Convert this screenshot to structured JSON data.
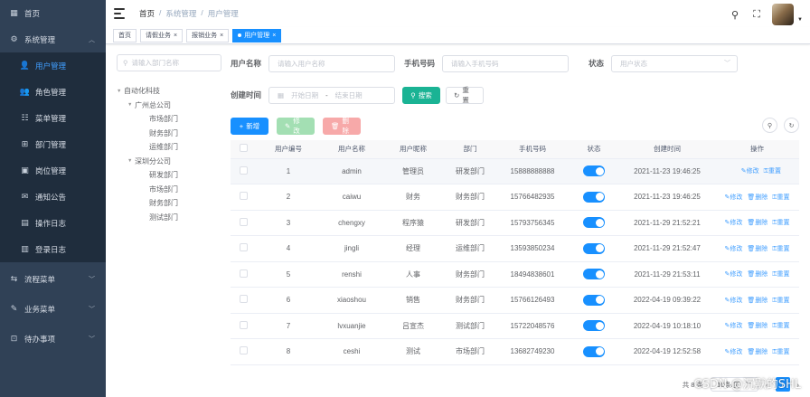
{
  "sidebar": {
    "home": "首页",
    "system": "系统管理",
    "sub": [
      {
        "label": "用户管理",
        "icon": "user-icon"
      },
      {
        "label": "角色管理",
        "icon": "people-icon"
      },
      {
        "label": "菜单管理",
        "icon": "tree-table-icon"
      },
      {
        "label": "部门管理",
        "icon": "tree-icon"
      },
      {
        "label": "岗位管理",
        "icon": "post-icon"
      },
      {
        "label": "通知公告",
        "icon": "message-icon"
      },
      {
        "label": "操作日志",
        "icon": "form-icon"
      },
      {
        "label": "登录日志",
        "icon": "logininfor-icon"
      }
    ],
    "groups": [
      "流程菜单",
      "业务菜单",
      "待办事项"
    ]
  },
  "navbar": {
    "breadcrumb": [
      "首页",
      "系统管理",
      "用户管理"
    ],
    "sep": "/"
  },
  "tags": [
    {
      "label": "首页"
    },
    {
      "label": "请假业务",
      "close": "×"
    },
    {
      "label": "报销业务",
      "close": "×"
    },
    {
      "label": "用户管理",
      "close": "×"
    }
  ],
  "dept": {
    "placeholder": "请输入部门名称",
    "tree": [
      {
        "label": "自动化科技",
        "level": 0,
        "caret": "▼"
      },
      {
        "label": "广州总公司",
        "level": 1,
        "caret": "▼"
      },
      {
        "label": "市场部门",
        "level": 2
      },
      {
        "label": "财务部门",
        "level": 2
      },
      {
        "label": "运维部门",
        "level": 2
      },
      {
        "label": "深圳分公司",
        "level": 1,
        "caret": "▼"
      },
      {
        "label": "研发部门",
        "level": 2
      },
      {
        "label": "市场部门",
        "level": 2
      },
      {
        "label": "财务部门",
        "level": 2
      },
      {
        "label": "测试部门",
        "level": 2
      }
    ]
  },
  "form": {
    "username_label": "用户名称",
    "username_placeholder": "请输入用户名称",
    "phone_label": "手机号码",
    "phone_placeholder": "请输入手机号码",
    "status_label": "状态",
    "status_placeholder": "用户状态",
    "time_label": "创建时间",
    "start_placeholder": "开始日期",
    "range_sep": "-",
    "end_placeholder": "结束日期",
    "search": "搜索",
    "reset": "重置"
  },
  "toolbar": {
    "add": "新增",
    "edit": "修改",
    "delete": "删除"
  },
  "table": {
    "headers": [
      "用户编号",
      "用户名称",
      "用户昵称",
      "部门",
      "手机号码",
      "状态",
      "创建时间",
      "操作"
    ],
    "rows": [
      {
        "id": "1",
        "name": "admin",
        "nick": "管理员",
        "dept": "研发部门",
        "phone": "15888888888",
        "time": "2021-11-23 19:46:25",
        "ops": [
          "修改",
          "重置"
        ]
      },
      {
        "id": "2",
        "name": "caiwu",
        "nick": "财务",
        "dept": "财务部门",
        "phone": "15766482935",
        "time": "2021-11-23 19:46:25",
        "ops": [
          "修改",
          "删除",
          "重置"
        ]
      },
      {
        "id": "3",
        "name": "chengxy",
        "nick": "程序猿",
        "dept": "研发部门",
        "phone": "15793756345",
        "time": "2021-11-29 21:52:21",
        "ops": [
          "修改",
          "删除",
          "重置"
        ]
      },
      {
        "id": "4",
        "name": "jingli",
        "nick": "经理",
        "dept": "运维部门",
        "phone": "13593850234",
        "time": "2021-11-29 21:52:47",
        "ops": [
          "修改",
          "删除",
          "重置"
        ]
      },
      {
        "id": "5",
        "name": "renshi",
        "nick": "人事",
        "dept": "财务部门",
        "phone": "18494838601",
        "time": "2021-11-29 21:53:11",
        "ops": [
          "修改",
          "删除",
          "重置"
        ]
      },
      {
        "id": "6",
        "name": "xiaoshou",
        "nick": "销售",
        "dept": "财务部门",
        "phone": "15766126493",
        "time": "2022-04-19 09:39:22",
        "ops": [
          "修改",
          "删除",
          "重置"
        ]
      },
      {
        "id": "7",
        "name": "lvxuanjie",
        "nick": "吕宣杰",
        "dept": "测试部门",
        "phone": "15722048576",
        "time": "2022-04-19 10:18:10",
        "ops": [
          "修改",
          "删除",
          "重置"
        ]
      },
      {
        "id": "8",
        "name": "ceshi",
        "nick": "测试",
        "dept": "市场部门",
        "phone": "13682749230",
        "time": "2022-04-19 12:52:58",
        "ops": [
          "修改",
          "删除",
          "重置"
        ]
      }
    ]
  },
  "pager": {
    "total": "共 8 条",
    "size": "10条/页",
    "page": "1"
  },
  "watermark": "CSDN @沉默的SHL",
  "colors": {
    "sidebar": "#304156",
    "submenu": "#1f2d3d",
    "primary": "#1890ff",
    "teal": "#1ab394"
  }
}
